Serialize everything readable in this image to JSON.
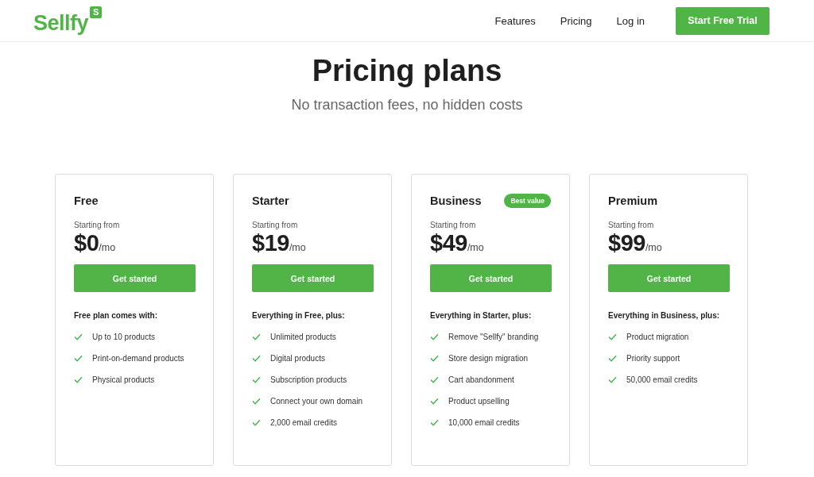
{
  "header": {
    "logo": {
      "text": "Sellfy",
      "badge": "S"
    },
    "nav": [
      {
        "label": "Features"
      },
      {
        "label": "Pricing"
      },
      {
        "label": "Log in"
      }
    ],
    "cta": "Start Free Trial"
  },
  "hero": {
    "title": "Pricing plans",
    "subtitle": "No transaction fees, no hidden costs"
  },
  "plans": [
    {
      "name": "Free",
      "starting": "Starting from",
      "price": "$0",
      "period": "/mo",
      "button": "Get started",
      "features_title": "Free plan comes with:",
      "features": [
        "Up to 10 products",
        "Print-on-demand products",
        "Physical products"
      ]
    },
    {
      "name": "Starter",
      "starting": "Starting from",
      "price": "$19",
      "period": "/mo",
      "button": "Get started",
      "features_title": "Everything in Free, plus:",
      "features": [
        "Unlimited products",
        "Digital products",
        "Subscription products",
        "Connect your own domain",
        "2,000 email credits"
      ]
    },
    {
      "name": "Business",
      "badge": "Best value",
      "starting": "Starting from",
      "price": "$49",
      "period": "/mo",
      "button": "Get started",
      "features_title": "Everything in Starter, plus:",
      "features": [
        "Remove \"Sellfy\" branding",
        "Store design migration",
        "Cart abandonment",
        "Product upselling",
        "10,000 email credits"
      ]
    },
    {
      "name": "Premium",
      "starting": "Starting from",
      "price": "$99",
      "period": "/mo",
      "button": "Get started",
      "features_title": "Everything in Business, plus:",
      "features": [
        "Product migration",
        "Priority support",
        "50,000 email credits"
      ]
    }
  ]
}
